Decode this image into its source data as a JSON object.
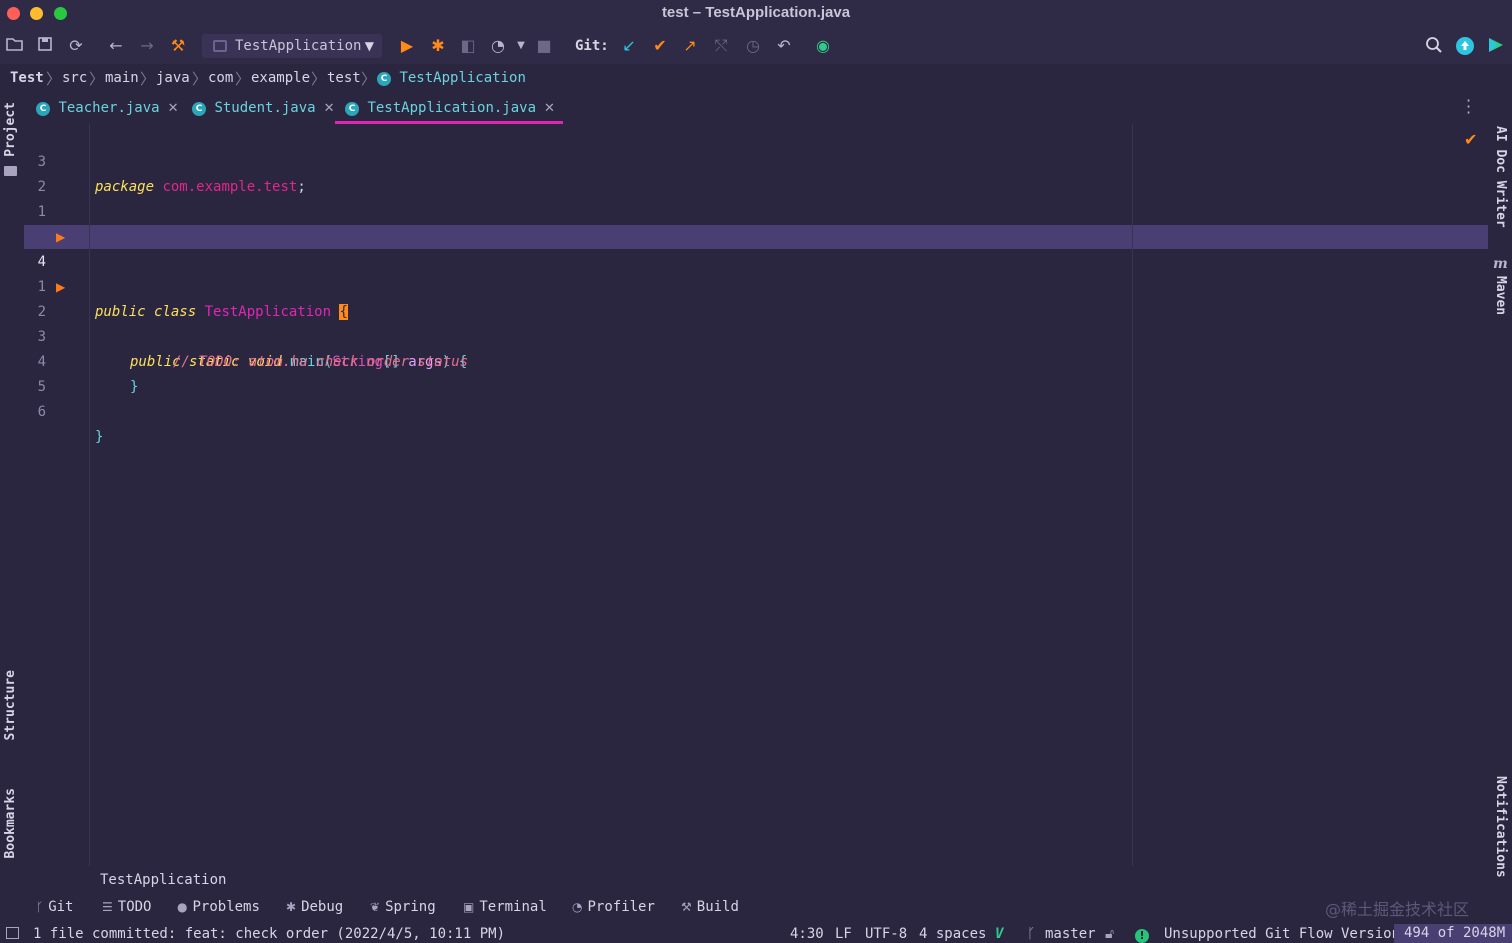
{
  "window": {
    "title": "test – TestApplication.java"
  },
  "toolbar": {
    "run_config": "TestApplication",
    "git_label": "Git:",
    "icons": [
      "folder-open-icon",
      "save-icon",
      "sync-icon",
      "back-arrow-icon",
      "forward-arrow-icon",
      "hammer-build-icon",
      "run-icon",
      "debug-icon",
      "coverage-icon",
      "profile-icon",
      "stop-icon",
      "git-update-icon",
      "git-commit-icon",
      "git-push-icon",
      "git-merge-icon",
      "git-history-icon",
      "git-rollback-icon",
      "plugin-icon",
      "search-icon",
      "upgrade-icon",
      "jetbrains-toolbox-icon"
    ]
  },
  "breadcrumb": {
    "items": [
      "Test",
      "src",
      "main",
      "java",
      "com",
      "example",
      "test"
    ],
    "last": "TestApplication"
  },
  "tabs": [
    {
      "label": "Teacher.java",
      "active": false
    },
    {
      "label": "Student.java",
      "active": false
    },
    {
      "label": "TestApplication.java",
      "active": true
    }
  ],
  "side_panels": {
    "left_top": "Project",
    "left_structure": "Structure",
    "left_bookmarks": "Bookmarks",
    "right_ai": "AI Doc Writer",
    "right_maven": "Maven",
    "right_notifications": "Notifications"
  },
  "editor": {
    "line_numbers": [
      "3",
      "2",
      "1",
      "",
      "4",
      "1",
      "2",
      "3",
      "4",
      "5",
      "6"
    ],
    "code": {
      "l1_kw": "package",
      "l1_pkg": "com.example.test",
      "l1_end": ";",
      "l4_kw": "public class",
      "l4_cls": "TestApplication",
      "l4_brace": "{",
      "l6_kw": "public static void",
      "l6_meth": "main",
      "l6_open": "(",
      "l6_type": "String",
      "l6_arr": "[]",
      "l6_param": "args",
      "l6_close": ") {",
      "l7_comment": "// TODO: atom.hu check order status",
      "l8_brace": "}",
      "l10_brace": "}"
    }
  },
  "bottom_crumb": "TestApplication",
  "tool_windows": [
    "Git",
    "TODO",
    "Problems",
    "Debug",
    "Spring",
    "Terminal",
    "Profiler",
    "Build"
  ],
  "watermark": "@稀土掘金技术社区",
  "status": {
    "message": "1 file committed: feat: check order (2022/4/5, 10:11 PM)",
    "position": "4:30",
    "line_sep": "LF",
    "encoding": "UTF-8",
    "indent": "4 spaces",
    "branch": "master",
    "git_flow": "Unsupported Git Flow Version",
    "memory": "494 of 2048M"
  },
  "colors": {
    "background": "#2b2640",
    "accent_tab": "#e026b4",
    "keyword": "#fbe05a",
    "class_name": "#e026b4",
    "method": "#6ad3dd",
    "comment": "#e86e8e",
    "run_arrow": "#ff7a1a"
  }
}
